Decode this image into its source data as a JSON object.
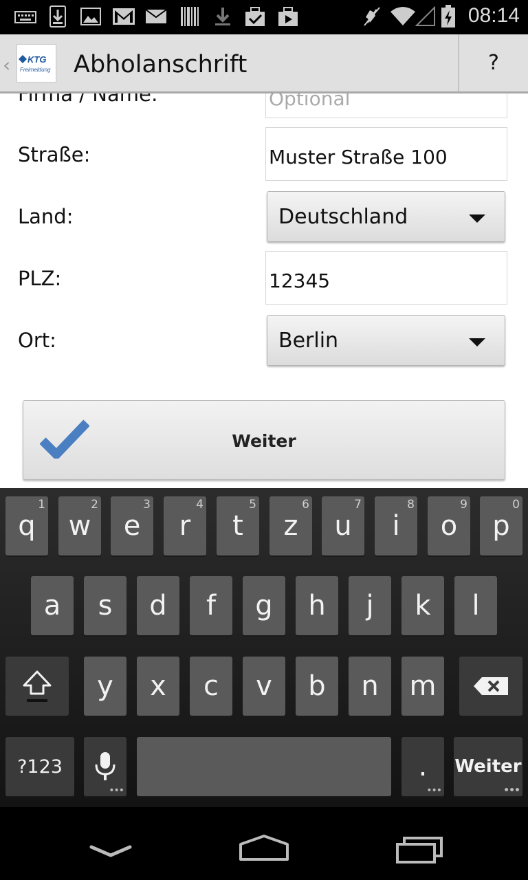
{
  "status_bar": {
    "time": "08:14",
    "icons": [
      "keyboard-icon",
      "download-icon",
      "image-icon",
      "gmail-icon",
      "mail-icon",
      "barcode-icon",
      "download-icon",
      "checklist-icon",
      "play-store-icon",
      "mute-icon",
      "wifi-icon",
      "signal-icon",
      "battery-charging-icon"
    ]
  },
  "action_bar": {
    "logo_text": "KTG",
    "logo_subtext": "Freimeldung",
    "title": "Abholanschrift",
    "help_label": "?"
  },
  "form": {
    "firma_label": "Firma / Name:",
    "firma_placeholder": "Optional",
    "strasse_label": "Straße:",
    "strasse_value": "Muster Straße 100",
    "land_label": "Land:",
    "land_value": "Deutschland",
    "plz_label": "PLZ:",
    "plz_value": "12345",
    "ort_label": "Ort:",
    "ort_value": "Berlin",
    "submit_label": "Weiter"
  },
  "keyboard": {
    "row1": [
      {
        "char": "q",
        "num": "1"
      },
      {
        "char": "w",
        "num": "2"
      },
      {
        "char": "e",
        "num": "3"
      },
      {
        "char": "r",
        "num": "4"
      },
      {
        "char": "t",
        "num": "5"
      },
      {
        "char": "z",
        "num": "6"
      },
      {
        "char": "u",
        "num": "7"
      },
      {
        "char": "i",
        "num": "8"
      },
      {
        "char": "o",
        "num": "9"
      },
      {
        "char": "p",
        "num": "0"
      }
    ],
    "row2": [
      "a",
      "s",
      "d",
      "f",
      "g",
      "h",
      "j",
      "k",
      "l"
    ],
    "row3": [
      "y",
      "x",
      "c",
      "v",
      "b",
      "n",
      "m"
    ],
    "symbols_label": "?123",
    "period_label": ".",
    "action_label": "Weiter"
  },
  "colors": {
    "accent_check": "#4a7fc1",
    "action_bar_bg": "#e0e0e0",
    "keyboard_key": "#5a5a5a"
  }
}
